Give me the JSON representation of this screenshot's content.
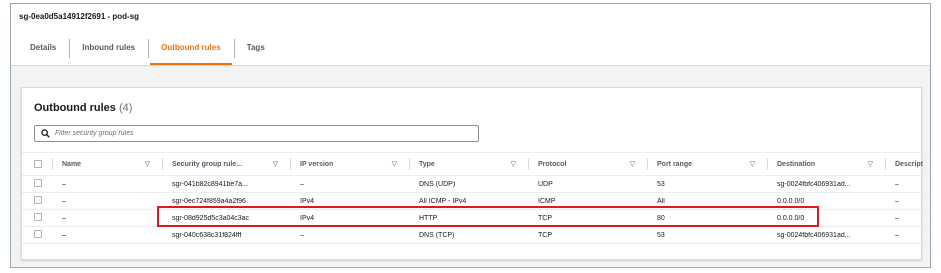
{
  "header": {
    "title": "sg-0ea0d5a14912f2691 - pod-sg"
  },
  "tabs": [
    "Details",
    "Inbound rules",
    "Outbound rules",
    "Tags"
  ],
  "active_tab": "Outbound rules",
  "panel": {
    "title": "Outbound rules",
    "count": "(4)"
  },
  "search": {
    "placeholder": "Filter security group rules"
  },
  "table": {
    "columns": [
      "Name",
      "Security group rule...",
      "IP version",
      "Type",
      "Protocol",
      "Port range",
      "Destination",
      "Descript"
    ],
    "rows": [
      [
        "–",
        "sgr-041b82c8941be7a...",
        "–",
        "DNS (UDP)",
        "UDP",
        "53",
        "sg-0024fbfc406931ad...",
        "–"
      ],
      [
        "–",
        "sgr-0ec724f859a4a2f96",
        "IPv4",
        "All ICMP - IPv4",
        "ICMP",
        "All",
        "0.0.0.0/0",
        "–"
      ],
      [
        "–",
        "sgr-08d925d5c3a04c3ac",
        "IPv4",
        "HTTP",
        "TCP",
        "80",
        "0.0.0.0/0",
        "–"
      ],
      [
        "–",
        "sgr-040c638c31f824fff",
        "–",
        "DNS (TCP)",
        "TCP",
        "53",
        "sg-0024fbfc406931ad...",
        "–"
      ]
    ],
    "highlighted_row": 2
  },
  "colors": {
    "active_tab": "#ec7211",
    "highlight_border": "#e0191e"
  },
  "icons": {
    "search": "search-icon",
    "sort": "sort-caret-icon",
    "checkbox": "checkbox-icon"
  }
}
